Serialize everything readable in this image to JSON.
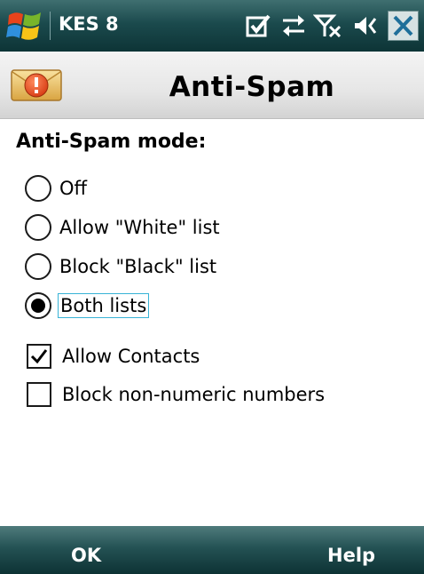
{
  "status_bar": {
    "app_name": "KES 8",
    "icons": [
      "windows-start-icon",
      "notification-check-icon",
      "connectivity-arrows-icon",
      "no-signal-icon",
      "volume-icon",
      "close-icon"
    ]
  },
  "title_bar": {
    "title": "Anti-Spam",
    "icon": "spam-envelope-alert-icon"
  },
  "content": {
    "section_title": "Anti-Spam mode:",
    "radio_options": [
      {
        "label": "Off",
        "selected": false
      },
      {
        "label": "Allow \"White\" list",
        "selected": false
      },
      {
        "label": "Block \"Black\" list",
        "selected": false
      },
      {
        "label": "Both lists",
        "selected": true
      }
    ],
    "checkboxes": [
      {
        "label": "Allow Contacts",
        "checked": true
      },
      {
        "label": "Block non-numeric numbers",
        "checked": false
      }
    ]
  },
  "softkeys": {
    "left": "OK",
    "right": "Help"
  },
  "colors": {
    "status_bar": "#1b4a4d",
    "softkey_bar": "#245254",
    "focus_border": "#38b3d6"
  }
}
